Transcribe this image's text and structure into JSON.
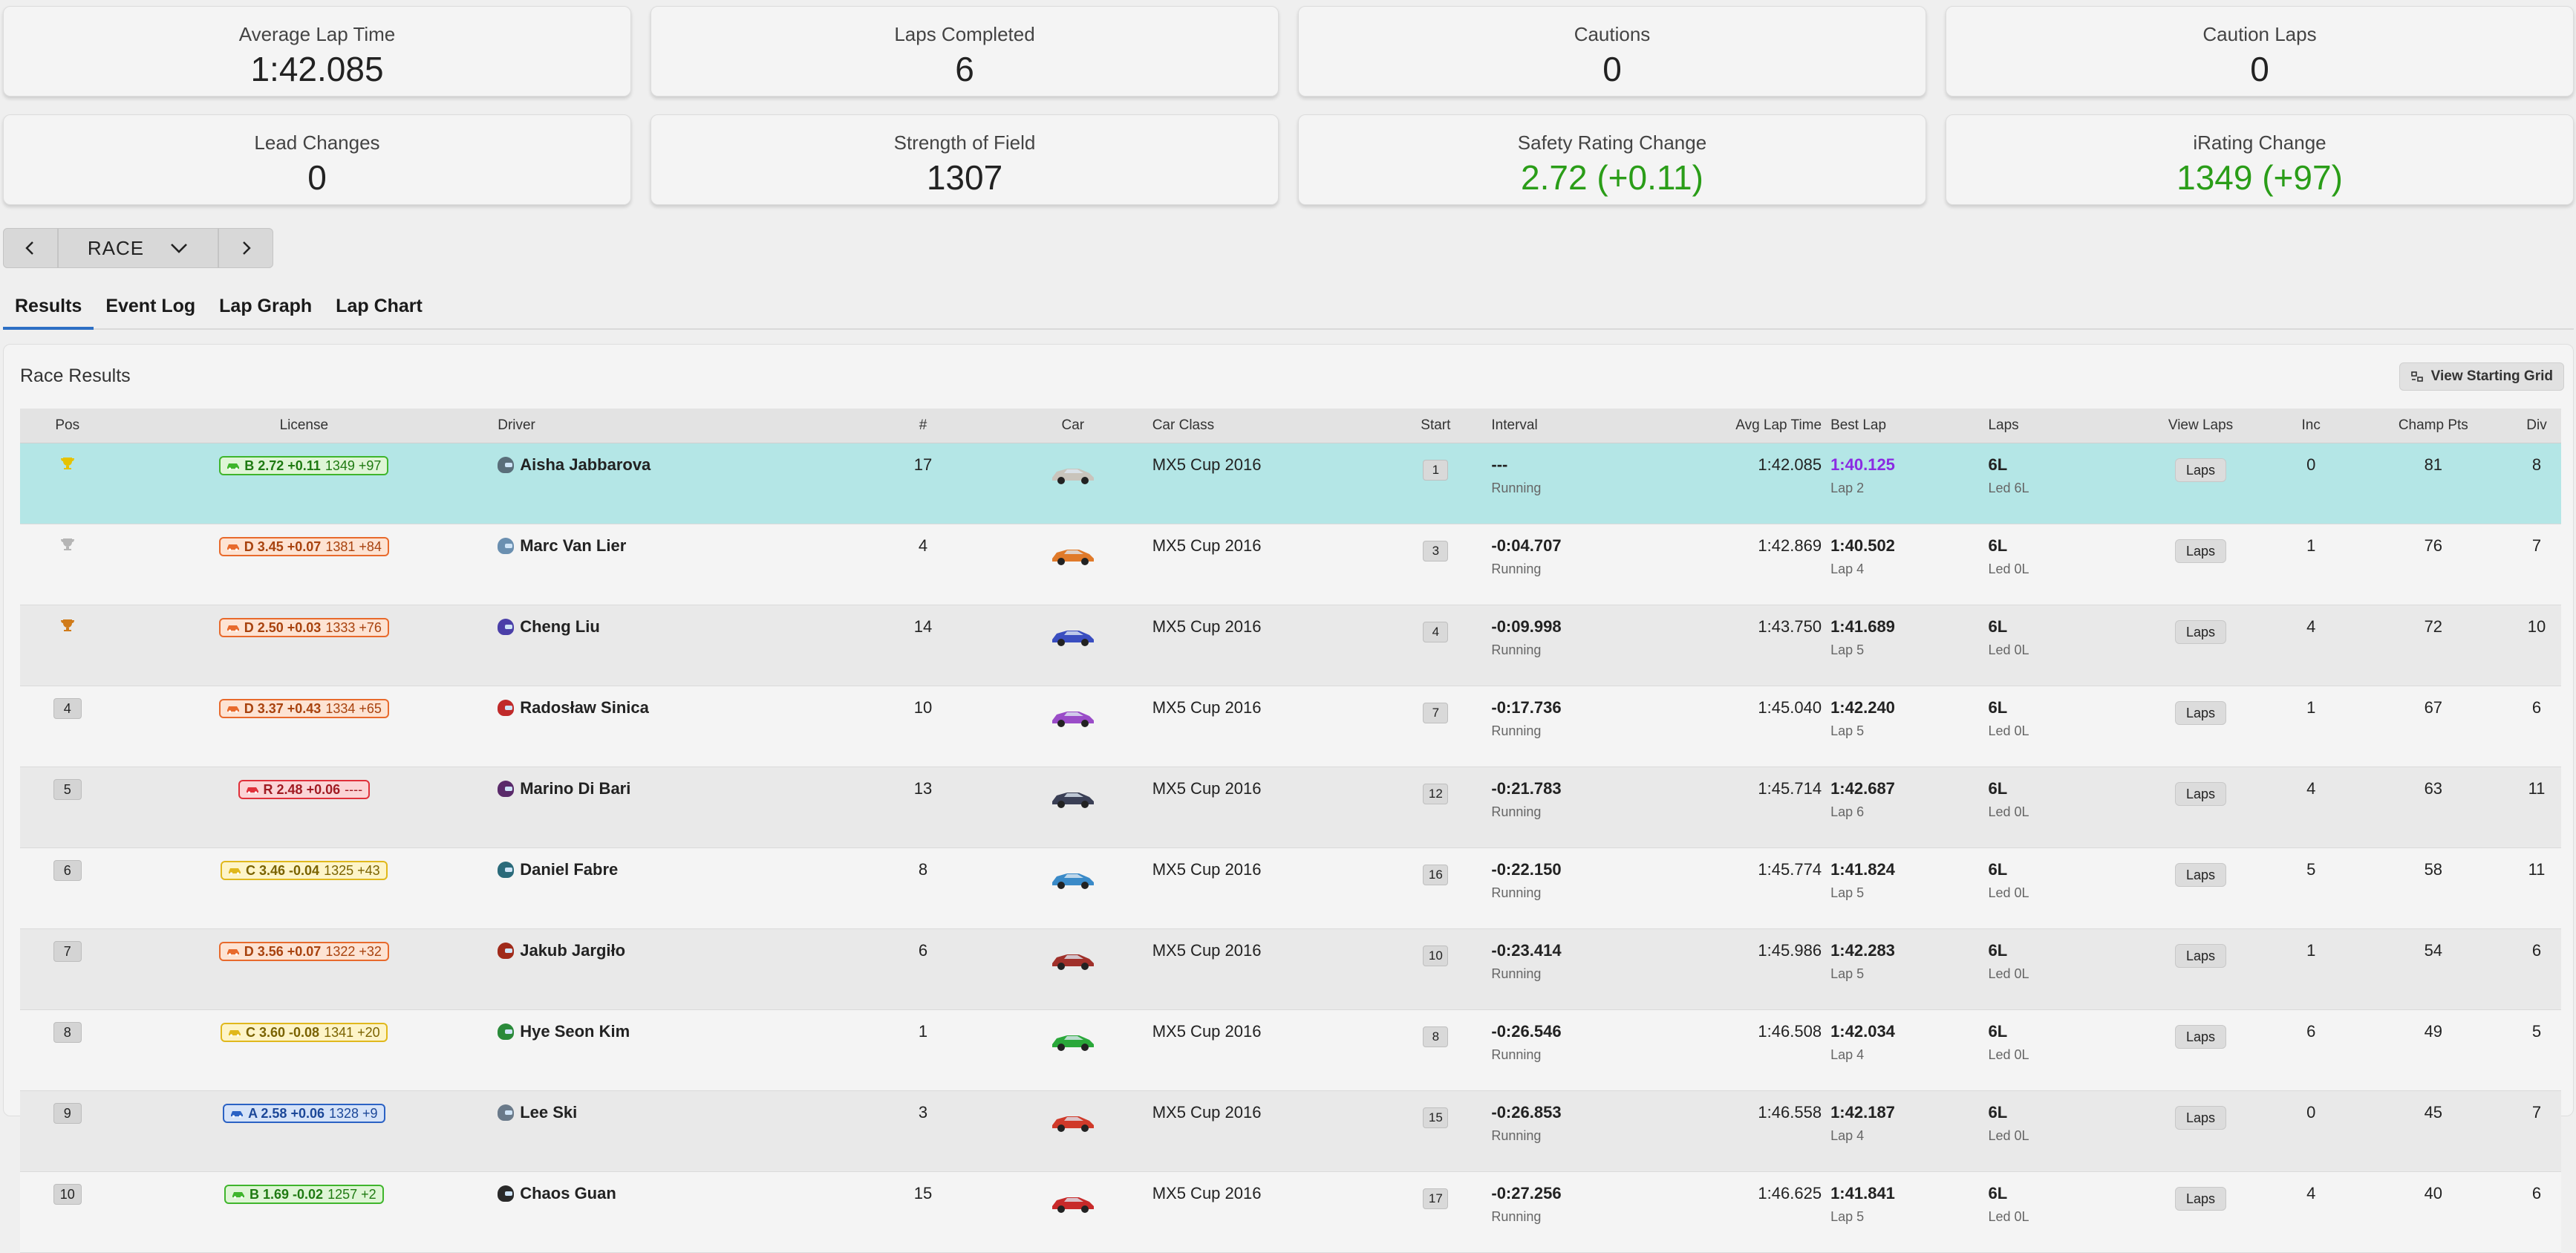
{
  "stats": [
    {
      "label": "Average Lap Time",
      "value": "1:42.085",
      "green": false
    },
    {
      "label": "Laps Completed",
      "value": "6",
      "green": false
    },
    {
      "label": "Cautions",
      "value": "0",
      "green": false
    },
    {
      "label": "Caution Laps",
      "value": "0",
      "green": false
    },
    {
      "label": "Lead Changes",
      "value": "0",
      "green": false
    },
    {
      "label": "Strength of Field",
      "value": "1307",
      "green": false
    },
    {
      "label": "Safety Rating Change",
      "value": "2.72 (+0.11)",
      "green": true
    },
    {
      "label": "iRating Change",
      "value": "1349 (+97)",
      "green": true
    }
  ],
  "session_select": {
    "label": "RACE"
  },
  "tabs": [
    {
      "label": "Results",
      "active": true
    },
    {
      "label": "Event Log",
      "active": false
    },
    {
      "label": "Lap Graph",
      "active": false
    },
    {
      "label": "Lap Chart",
      "active": false
    }
  ],
  "panel": {
    "title": "Race Results",
    "grid_button": "View Starting Grid"
  },
  "columns": {
    "pos": "Pos",
    "license": "License",
    "driver": "Driver",
    "num": "#",
    "car": "Car",
    "car_class": "Car Class",
    "start": "Start",
    "interval": "Interval",
    "avg_lap": "Avg Lap Time",
    "best_lap": "Best Lap",
    "laps": "Laps",
    "view_laps": "View Laps",
    "inc": "Inc",
    "champ_pts": "Champ Pts",
    "div": "Div"
  },
  "colors": {
    "green": "#2a9d18",
    "license_B": "#3fb52c",
    "license_D": "#e86a2c",
    "license_R": "#e0303a",
    "license_C": "#e0b81c",
    "license_A": "#2b62c4",
    "highlight_row": "#b4e6e6",
    "best_lap_purple": "#8a2be2"
  },
  "rows": [
    {
      "pos": "",
      "trophy": "#e6c200",
      "lic_class": "B",
      "lic": "B 2.72 +0.11",
      "ir": "1349 +97",
      "helmet": "#5a6e7a",
      "driver": "Aisha Jabbarova",
      "num": "17",
      "car_color": "#c9c4bc",
      "car_class": "MX5 Cup 2016",
      "start": "1",
      "interval": "---",
      "status": "Running",
      "avg": "1:42.085",
      "best": "1:40.125",
      "best_lap": "Lap 2",
      "best_purple": true,
      "laps": "6L",
      "led": "Led 6L",
      "laps_btn": "Laps",
      "inc": "0",
      "pts": "81",
      "div": "8"
    },
    {
      "pos": "",
      "trophy": "#b5b5b5",
      "lic_class": "D",
      "lic": "D 3.45 +0.07",
      "ir": "1381 +84",
      "helmet": "#6a8fb0",
      "driver": "Marc Van Lier",
      "num": "4",
      "car_color": "#e07a2a",
      "car_class": "MX5 Cup 2016",
      "start": "3",
      "interval": "-0:04.707",
      "status": "Running",
      "avg": "1:42.869",
      "best": "1:40.502",
      "best_lap": "Lap 4",
      "best_purple": false,
      "laps": "6L",
      "led": "Led 0L",
      "laps_btn": "Laps",
      "inc": "1",
      "pts": "76",
      "div": "7"
    },
    {
      "pos": "",
      "trophy": "#d07b1a",
      "lic_class": "D",
      "lic": "D 2.50 +0.03",
      "ir": "1333 +76",
      "helmet": "#4a3fa8",
      "driver": "Cheng Liu",
      "num": "14",
      "car_color": "#3a4ec0",
      "car_class": "MX5 Cup 2016",
      "start": "4",
      "interval": "-0:09.998",
      "status": "Running",
      "avg": "1:43.750",
      "best": "1:41.689",
      "best_lap": "Lap 5",
      "best_purple": false,
      "laps": "6L",
      "led": "Led 0L",
      "laps_btn": "Laps",
      "inc": "4",
      "pts": "72",
      "div": "10"
    },
    {
      "pos": "4",
      "trophy": "",
      "lic_class": "D",
      "lic": "D 3.37 +0.43",
      "ir": "1334 +65",
      "helmet": "#c02a2a",
      "driver": "Radosław Sinica",
      "num": "10",
      "car_color": "#9a4cc8",
      "car_class": "MX5 Cup 2016",
      "start": "7",
      "interval": "-0:17.736",
      "status": "Running",
      "avg": "1:45.040",
      "best": "1:42.240",
      "best_lap": "Lap 5",
      "best_purple": false,
      "laps": "6L",
      "led": "Led 0L",
      "laps_btn": "Laps",
      "inc": "1",
      "pts": "67",
      "div": "6"
    },
    {
      "pos": "5",
      "trophy": "",
      "lic_class": "R",
      "lic": "R 2.48 +0.06",
      "ir": "----",
      "helmet": "#5a2a6a",
      "driver": "Marino Di Bari",
      "num": "13",
      "car_color": "#3a3f55",
      "car_class": "MX5 Cup 2016",
      "start": "12",
      "interval": "-0:21.783",
      "status": "Running",
      "avg": "1:45.714",
      "best": "1:42.687",
      "best_lap": "Lap 6",
      "best_purple": false,
      "laps": "6L",
      "led": "Led 0L",
      "laps_btn": "Laps",
      "inc": "4",
      "pts": "63",
      "div": "11"
    },
    {
      "pos": "6",
      "trophy": "",
      "lic_class": "C",
      "lic": "C 3.46 -0.04",
      "ir": "1325 +43",
      "helmet": "#2a6a7a",
      "driver": "Daniel Fabre",
      "num": "8",
      "car_color": "#3a8ac8",
      "car_class": "MX5 Cup 2016",
      "start": "16",
      "interval": "-0:22.150",
      "status": "Running",
      "avg": "1:45.774",
      "best": "1:41.824",
      "best_lap": "Lap 5",
      "best_purple": false,
      "laps": "6L",
      "led": "Led 0L",
      "laps_btn": "Laps",
      "inc": "5",
      "pts": "58",
      "div": "11"
    },
    {
      "pos": "7",
      "trophy": "",
      "lic_class": "D",
      "lic": "D 3.56 +0.07",
      "ir": "1322 +32",
      "helmet": "#a02a1a",
      "driver": "Jakub Jargiło",
      "num": "6",
      "car_color": "#a0302a",
      "car_class": "MX5 Cup 2016",
      "start": "10",
      "interval": "-0:23.414",
      "status": "Running",
      "avg": "1:45.986",
      "best": "1:42.283",
      "best_lap": "Lap 5",
      "best_purple": false,
      "laps": "6L",
      "led": "Led 0L",
      "laps_btn": "Laps",
      "inc": "1",
      "pts": "54",
      "div": "6"
    },
    {
      "pos": "8",
      "trophy": "",
      "lic_class": "C",
      "lic": "C 3.60 -0.08",
      "ir": "1341 +20",
      "helmet": "#2a8a3a",
      "driver": "Hye Seon Kim",
      "num": "1",
      "car_color": "#2aa83a",
      "car_class": "MX5 Cup 2016",
      "start": "8",
      "interval": "-0:26.546",
      "status": "Running",
      "avg": "1:46.508",
      "best": "1:42.034",
      "best_lap": "Lap 4",
      "best_purple": false,
      "laps": "6L",
      "led": "Led 0L",
      "laps_btn": "Laps",
      "inc": "6",
      "pts": "49",
      "div": "5"
    },
    {
      "pos": "9",
      "trophy": "",
      "lic_class": "A",
      "lic": "A 2.58 +0.06",
      "ir": "1328 +9",
      "helmet": "#6a7a8a",
      "driver": "Lee Ski",
      "num": "3",
      "car_color": "#d03a2a",
      "car_class": "MX5 Cup 2016",
      "start": "15",
      "interval": "-0:26.853",
      "status": "Running",
      "avg": "1:46.558",
      "best": "1:42.187",
      "best_lap": "Lap 4",
      "best_purple": false,
      "laps": "6L",
      "led": "Led 0L",
      "laps_btn": "Laps",
      "inc": "0",
      "pts": "45",
      "div": "7"
    },
    {
      "pos": "10",
      "trophy": "",
      "lic_class": "B",
      "lic": "B 1.69 -0.02",
      "ir": "1257 +2",
      "helmet": "#2a2a2a",
      "driver": "Chaos Guan",
      "num": "15",
      "car_color": "#c82a2a",
      "car_class": "MX5 Cup 2016",
      "start": "17",
      "interval": "-0:27.256",
      "status": "Running",
      "avg": "1:46.625",
      "best": "1:41.841",
      "best_lap": "Lap 5",
      "best_purple": false,
      "laps": "6L",
      "led": "Led 0L",
      "laps_btn": "Laps",
      "inc": "4",
      "pts": "40",
      "div": "6"
    }
  ]
}
